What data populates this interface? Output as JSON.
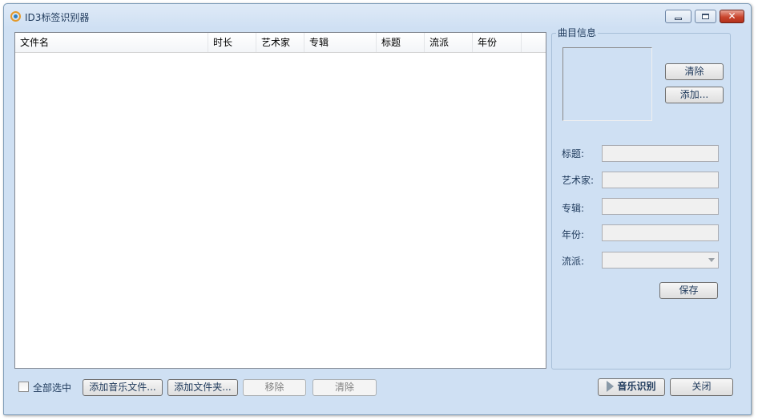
{
  "window": {
    "title": "ID3标签识别器"
  },
  "list": {
    "columns": [
      "文件名",
      "时长",
      "艺术家",
      "专辑",
      "标题",
      "流派",
      "年份"
    ]
  },
  "track_info": {
    "group_label": "曲目信息",
    "clear_label": "清除",
    "add_label": "添加...",
    "fields": {
      "title_label": "标题:",
      "artist_label": "艺术家:",
      "album_label": "专辑:",
      "year_label": "年份:",
      "genre_label": "流派:"
    },
    "save_label": "保存"
  },
  "footer": {
    "select_all_label": "全部选中",
    "select_all_checked": false,
    "add_files_label": "添加音乐文件...",
    "add_folder_label": "添加文件夹...",
    "remove_label": "移除",
    "clear_label": "清除",
    "recognize_label": "音乐识别",
    "close_label": "关闭"
  }
}
